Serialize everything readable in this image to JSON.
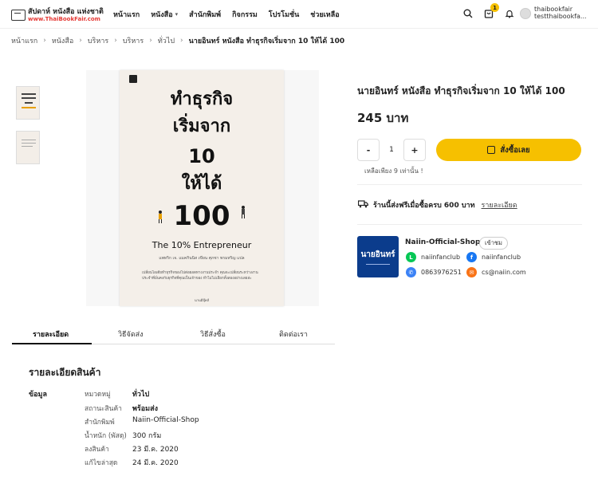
{
  "header": {
    "logo_main": "สัปดาห์ หนังสือ แห่งชาติ",
    "logo_url": "www.ThaiBookFair.com",
    "nav": [
      "หน้าแรก",
      "หนังสือ",
      "สำนักพิมพ์",
      "กิจกรรม",
      "โปรโมชั่น",
      "ช่วยเหลือ"
    ],
    "cart_count": "1",
    "user_name": "thaibookfair",
    "user_email": "testthaibookfa..."
  },
  "breadcrumb": {
    "items": [
      "หน้าแรก",
      "หนังสือ",
      "บริหาร",
      "บริหาร",
      "ทั่วไป"
    ],
    "current": "นายอินทร์ หนังสือ ทำธุรกิจเริ่มจาก 10 ให้ได้ 100"
  },
  "cover": {
    "line1": "ทำธุรกิจ",
    "line2": "เริ่มจาก",
    "line3": "10",
    "line4": "ให้ได้",
    "line5": "100",
    "subtitle": "The 10% Entrepreneur",
    "authors": "แพทริก เจ. แมคกินนิส เขียน  ศุภชา พรมหริญ แปล",
    "desc": "เปลี่ยนไอเดียทำธุรกิจของไปต่อยอดทางงานประจำ คุณจะเปลี่ยนระหว่างงานประจำที่มั่นคงกับธุรกิจที่คุณเป็นเจ้าของ ทำไมไม่เลือกทั้งสองอย่างเลยล่ะ",
    "brand": "นานมีบุ๊คส์"
  },
  "product": {
    "title": "นายอินทร์ หนังสือ ทำธุรกิจเริ่มจาก 10 ให้ได้ 100",
    "price": "245 บาท",
    "qty_minus": "-",
    "qty": "1",
    "qty_plus": "+",
    "buy_label": "สั่งซื้อเลย",
    "stock_note": "เหลือเพียง 9 เท่านั้น !",
    "shipping_text": "ร้านนี้ส่งฟรีเมื่อซื้อครบ 600 บาท",
    "shipping_link": "รายละเอียด"
  },
  "shop": {
    "logo_text": "นายอินทร์",
    "name": "Naiin-Official-Shop",
    "visit_label": "เข้าชม",
    "line": "naiinfanclub",
    "facebook": "naiinfanclub",
    "phone": "0863976251",
    "email": "cs@naiin.com"
  },
  "tabs": [
    "รายละเอียด",
    "วิธีจัดส่ง",
    "วิธีสั่งซื้อ",
    "ติดต่อเรา"
  ],
  "details": {
    "heading": "รายละเอียดสินค้า",
    "section": "ข้อมูล",
    "rows": [
      {
        "label": "หมวดหมู่",
        "value": "ทั่วไป"
      },
      {
        "label": "สถานะสินค้า",
        "value": "พร้อมส่ง"
      },
      {
        "label": "สำนักพิมพ์",
        "value": "Naiin-Official-Shop"
      },
      {
        "label": "น้ำหนัก (พัสดุ)",
        "value": "300 กรัม"
      },
      {
        "label": "ลงสินค้า",
        "value": "23 มี.ค. 2020"
      },
      {
        "label": "แก้ไขล่าสุด",
        "value": "24 มี.ค. 2020"
      }
    ]
  },
  "colors": {
    "accent": "#f6c000",
    "logo_red": "#e53935",
    "shop_blue": "#0b3c8c",
    "line_green": "#06c755",
    "facebook_blue": "#1877f2",
    "phone_blue": "#3b82f6",
    "email_orange": "#f97316"
  }
}
